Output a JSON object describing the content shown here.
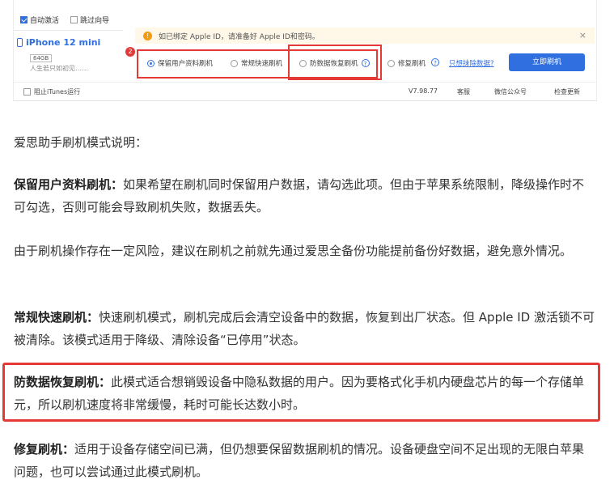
{
  "app": {
    "auto_activate": "自动激活",
    "skip_guide": "跳过向导",
    "device_name": "iPhone 12 mini",
    "capacity": "64GB",
    "motto": "人生若只如初见……",
    "badge": "2",
    "notice": "如已绑定 Apple ID，请准备好 Apple ID和密码。",
    "close": "×",
    "modes": [
      "保留用户资料刷机",
      "常规快速刷机",
      "防数据恢复刷机",
      "修复刷机"
    ],
    "selected_mode": 0,
    "help_q": "?",
    "erase_link": "只想抹除数据?",
    "flash_button": "立即刷机",
    "block_itunes": "阻止iTunes运行",
    "version": "V7.98.77",
    "client": "客服",
    "wechat": "微信公众号",
    "update": "检查更新"
  },
  "article": {
    "intro": "爱思助手刷机模式说明：",
    "p1_title": "保留用户资料刷机：",
    "p1_text": "如果希望在刷机同时保留用户数据，请勾选此项。但由于苹果系统限制，降级操作时不可勾选，否则可能会导致刷机失败，数据丢失。",
    "p2_text": "由于刷机操作存在一定风险，建议在刷机之前就先通过爱思全备份功能提前备份好数据，避免意外情况。",
    "p3_title": "常规快速刷机：",
    "p3_text": "快速刷机模式，刷机完成后会清空设备中的数据，恢复到出厂状态。但 Apple ID 激活锁不可被清除。该模式适用于降级、清除设备“已停用”状态。",
    "p4_title": "防数据恢复刷机：",
    "p4_text": "此模式适合想销毁设备中隐私数据的用户。因为要格式化手机内硬盘芯片的每一个存储单元，所以刷机速度将非常缓慢，耗时可能长达数小时。",
    "p5_title": "修复刷机：",
    "p5_text": "适用于设备存储空间已满，但仍想要保留数据刷机的情况。设备硬盘空间不足出现的无限白苹果问题，也可以尝试通过此模式刷机。"
  },
  "colors": {
    "accent": "#2f6fe0",
    "highlight": "#e53935",
    "warning": "#f39c12"
  },
  "icons": [
    "phone-icon",
    "warning-icon",
    "help-icon",
    "close-icon"
  ]
}
